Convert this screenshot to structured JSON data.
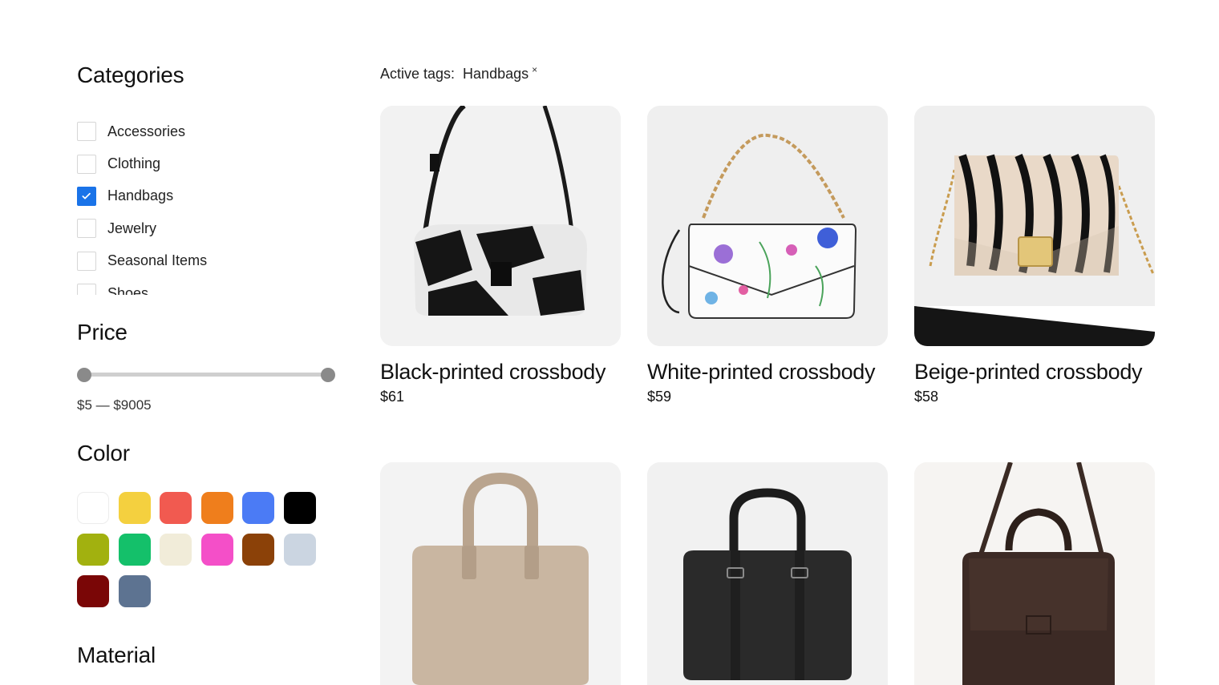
{
  "filters": {
    "categories_title": "Categories",
    "categories": [
      {
        "label": "Accessories",
        "checked": false
      },
      {
        "label": "Clothing",
        "checked": false
      },
      {
        "label": "Handbags",
        "checked": true
      },
      {
        "label": "Jewelry",
        "checked": false
      },
      {
        "label": "Seasonal Items",
        "checked": false
      },
      {
        "label": "Shoes",
        "checked": false
      }
    ],
    "price_title": "Price",
    "price_range": "$5 — $9005",
    "color_title": "Color",
    "colors": [
      "#ffffff",
      "#f4d03f",
      "#f15a50",
      "#ef7e1c",
      "#4b7bf5",
      "#000000",
      "#a2b10f",
      "#14c06a",
      "#f1ecd9",
      "#f44fc8",
      "#8b4108",
      "#cbd5e1",
      "#7a0606",
      "#5d7391"
    ],
    "material_title": "Material"
  },
  "active_tags": {
    "label": "Active tags:",
    "tags": [
      {
        "label": "Handbags",
        "remove": "×"
      }
    ]
  },
  "products": [
    {
      "name": "Black-printed crossbody",
      "price": "$61"
    },
    {
      "name": "White-printed crossbody",
      "price": "$59"
    },
    {
      "name": "Beige-printed crossbody",
      "price": "$58"
    },
    {
      "name": "",
      "price": ""
    },
    {
      "name": "",
      "price": ""
    },
    {
      "name": "",
      "price": ""
    }
  ]
}
